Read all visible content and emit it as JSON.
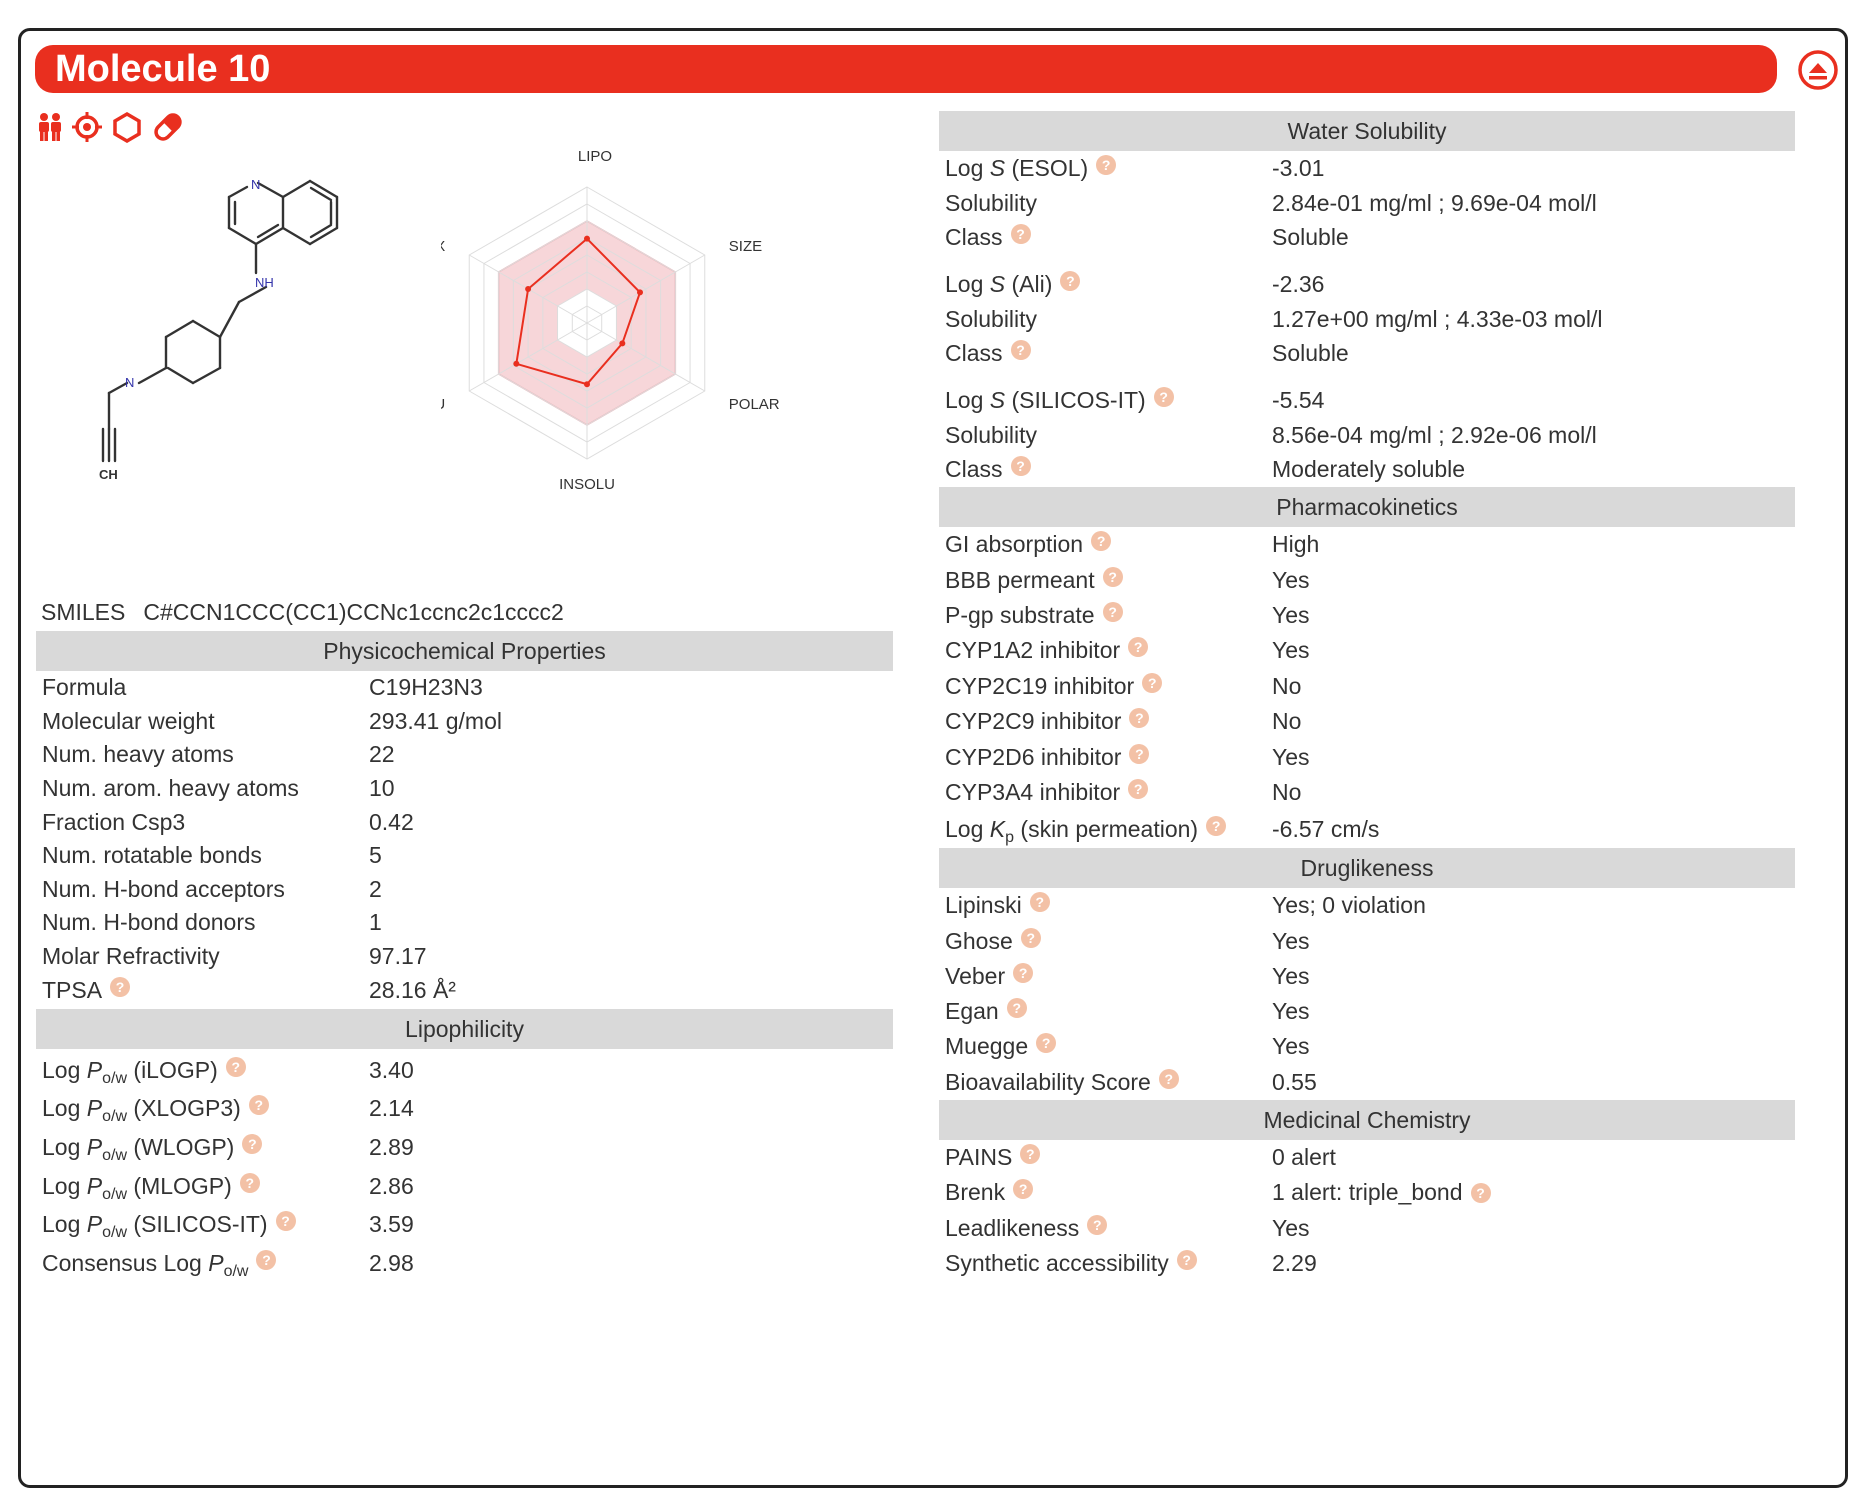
{
  "title": "Molecule 10",
  "toolbar_icons": [
    "people-icon",
    "target-icon",
    "hexagon-icon",
    "pill-icon"
  ],
  "structure": {
    "atom_labels": [
      "N",
      "NH",
      "N",
      "CH"
    ]
  },
  "radar": {
    "axes": [
      "LIPO",
      "SIZE",
      "POLAR",
      "INSOLU",
      "INSATU",
      "FLEX"
    ],
    "values": [
      0.62,
      0.45,
      0.3,
      0.45,
      0.6,
      0.5
    ]
  },
  "smiles": {
    "label": "SMILES",
    "value": "C#CCN1CCC(CC1)CCNc1ccnc2c1cccc2"
  },
  "physchem": {
    "header": "Physicochemical Properties",
    "rows": [
      {
        "label": "Formula",
        "value": "C19H23N3"
      },
      {
        "label": "Molecular weight",
        "value": "293.41 g/mol"
      },
      {
        "label": "Num. heavy atoms",
        "value": "22"
      },
      {
        "label": "Num. arom. heavy atoms",
        "value": "10"
      },
      {
        "label": "Fraction Csp3",
        "value": "0.42"
      },
      {
        "label": "Num. rotatable bonds",
        "value": "5"
      },
      {
        "label": "Num. H-bond acceptors",
        "value": "2"
      },
      {
        "label": "Num. H-bond donors",
        "value": "1"
      },
      {
        "label": "Molar Refractivity",
        "value": "97.17"
      },
      {
        "label": "TPSA",
        "value": "28.16 Å²"
      }
    ]
  },
  "lipo": {
    "header": "Lipophilicity",
    "rows": [
      {
        "pre": "Log ",
        "sym": "P",
        "sub": "o/w",
        "post": " (iLOGP)",
        "value": "3.40"
      },
      {
        "pre": "Log ",
        "sym": "P",
        "sub": "o/w",
        "post": " (XLOGP3)",
        "value": "2.14"
      },
      {
        "pre": "Log ",
        "sym": "P",
        "sub": "o/w",
        "post": " (WLOGP)",
        "value": "2.89"
      },
      {
        "pre": "Log ",
        "sym": "P",
        "sub": "o/w",
        "post": " (MLOGP)",
        "value": "2.86"
      },
      {
        "pre": "Log ",
        "sym": "P",
        "sub": "o/w",
        "post": " (SILICOS-IT)",
        "value": "3.59"
      },
      {
        "pre": "Consensus Log ",
        "sym": "P",
        "sub": "o/w",
        "post": "",
        "value": "2.98"
      }
    ]
  },
  "water": {
    "header": "Water Solubility",
    "groups": [
      {
        "logs_pre": "Log ",
        "logs_sym": "S",
        "logs_post": " (ESOL)",
        "logs_value": "-3.01",
        "sol_label": "Solubility",
        "sol_value": "2.84e-01 mg/ml ; 9.69e-04 mol/l",
        "class_label": "Class",
        "class_value": "Soluble"
      },
      {
        "logs_pre": "Log ",
        "logs_sym": "S",
        "logs_post": " (Ali)",
        "logs_value": "-2.36",
        "sol_label": "Solubility",
        "sol_value": "1.27e+00 mg/ml ; 4.33e-03 mol/l",
        "class_label": "Class",
        "class_value": "Soluble"
      },
      {
        "logs_pre": "Log ",
        "logs_sym": "S",
        "logs_post": " (SILICOS-IT)",
        "logs_value": "-5.54",
        "sol_label": "Solubility",
        "sol_value": "8.56e-04 mg/ml ; 2.92e-06 mol/l",
        "class_label": "Class",
        "class_value": "Moderately soluble"
      }
    ]
  },
  "pk": {
    "header": "Pharmacokinetics",
    "rows": [
      {
        "label": "GI absorption",
        "value": "High"
      },
      {
        "label": "BBB permeant",
        "value": "Yes"
      },
      {
        "label": "P-gp substrate",
        "value": "Yes"
      },
      {
        "label": "CYP1A2 inhibitor",
        "value": "Yes"
      },
      {
        "label": "CYP2C19 inhibitor",
        "value": "No"
      },
      {
        "label": "CYP2C9 inhibitor",
        "value": "No"
      },
      {
        "label": "CYP2D6 inhibitor",
        "value": "Yes"
      },
      {
        "label": "CYP3A4 inhibitor",
        "value": "No"
      }
    ],
    "kp": {
      "pre": "Log ",
      "sym": "K",
      "sub": "p",
      "post": " (skin permeation)",
      "value": "-6.57 cm/s"
    }
  },
  "drug": {
    "header": "Druglikeness",
    "rows": [
      {
        "label": "Lipinski",
        "value": "Yes; 0 violation"
      },
      {
        "label": "Ghose",
        "value": "Yes"
      },
      {
        "label": "Veber",
        "value": "Yes"
      },
      {
        "label": "Egan",
        "value": "Yes"
      },
      {
        "label": "Muegge",
        "value": "Yes"
      },
      {
        "label": "Bioavailability Score",
        "value": "0.55"
      }
    ]
  },
  "medchem": {
    "header": "Medicinal Chemistry",
    "rows": [
      {
        "label": "PAINS",
        "value": "0 alert",
        "help_value": false
      },
      {
        "label": "Brenk",
        "value": "1 alert: triple_bond",
        "help_value": true
      },
      {
        "label": "Leadlikeness",
        "value": "Yes",
        "help_value": false
      },
      {
        "label": "Synthetic accessibility",
        "value": "2.29",
        "help_value": false
      }
    ]
  },
  "colors": {
    "brand": "#e92f1f",
    "header_bg": "#d9d9d9",
    "help": "#f3c1a6"
  }
}
